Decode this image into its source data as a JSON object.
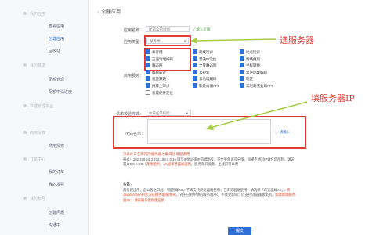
{
  "sidebar": {
    "groups": [
      "我的应用",
      "我的数据",
      "数据管理平台",
      "商用授权",
      "订单中心",
      "我的账号"
    ],
    "items": [
      "查看应用",
      "创建应用",
      "回收站",
      "配额管理",
      "配额申请进度",
      "商用授权",
      "我的订单",
      "我的发票",
      "创建问题",
      "沟通中"
    ],
    "active_item": "创建应用"
  },
  "page": {
    "title": "创建应用"
  },
  "form": {
    "app_name_label": "应用名称：",
    "app_name_value": "民审众审批图",
    "app_name_hint": "输入正确",
    "app_type_label": "应用类型：",
    "app_type_value": "服务端",
    "enable_service_label": "启用服务：",
    "services": [
      {
        "label": "云存储",
        "checked": true
      },
      {
        "label": "路线检索",
        "checked": true
      },
      {
        "label": "地点检索",
        "checked": true
      },
      {
        "label": "正逆地理编码",
        "checked": true
      },
      {
        "label": "普通IP定位",
        "checked": true
      },
      {
        "label": "路线规划",
        "checked": true
      },
      {
        "label": "静态图",
        "checked": true
      },
      {
        "label": "全景静态图",
        "checked": true
      },
      {
        "label": "坐标转换",
        "checked": true
      },
      {
        "label": "鹰眼轨迹",
        "checked": true
      },
      {
        "label": "云检索",
        "checked": true
      },
      {
        "label": "云逆地理编码",
        "checked": true
      },
      {
        "label": "批量算路",
        "checked": true
      },
      {
        "label": "云地理编码",
        "checked": true
      },
      {
        "label": "时区",
        "checked": true
      },
      {
        "label": "推荐上车点",
        "checked": true
      },
      {
        "label": "轨迹纠偏API",
        "checked": true
      },
      {
        "label": "实时路况查询API",
        "checked": true
      },
      {
        "label": "智能硬件定位",
        "checked": false
      }
    ],
    "verify_label": "请求校验方式：",
    "verify_value": "IP白名单校验",
    "whitelist_label": "IP白名单：",
    "whitelist_hint": "请输入",
    "note_title": "只有IP白名单内的服务器才能成功发起调用",
    "note_body_1": "格式：202.198.16.3,202.198.0.0/16 填写IP地址或IP前缀网段，英文半角逗号分隔。如果不想对IP做任何限制，请设置为0.0.0.0/0（",
    "note_body_hl": "谨慎使用，AK如果泄露被盗用，",
    "note_body_2": "服务商开发者，上线前可以用",
    "public_title": "公告：",
    "public_body_1": "服务端应用，自公告之日起，「服务端AK」不再支持浏览器端使用；在浏览器端使用，请选择「浏览器端AK」，",
    "public_body_hl": "将JavaScript API无法在服务端调用AK",
    "public_body_2": "对于已经申请的服务端AK，不会受影响；仍支持浏览器端使用，",
    "public_body_hl2": "如需新增服务端AK，请在服务端创建应用",
    "submit": "提交"
  },
  "annotations": {
    "select_server": "选服务器",
    "fill_ip": "填服务器IP"
  },
  "colors": {
    "accent": "#2f6fd6",
    "annotation": "#e53935",
    "hint": "#4aa54a"
  }
}
